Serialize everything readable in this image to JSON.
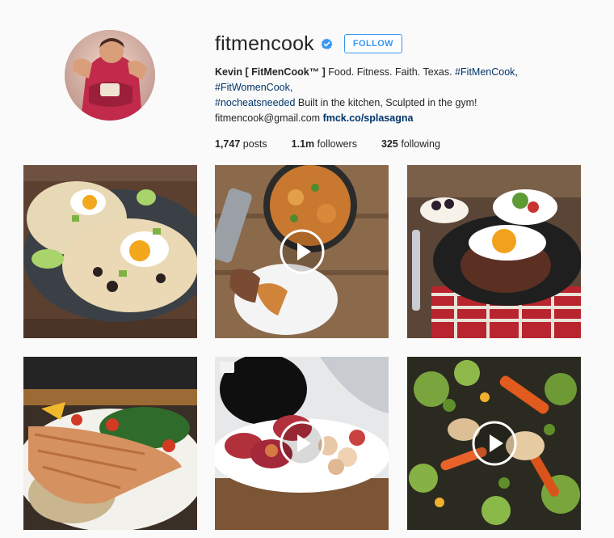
{
  "profile": {
    "username": "fitmencook",
    "follow_label": "FOLLOW",
    "bio": {
      "full_name": "Kevin [ FitMenCook™ ]",
      "text1": " Food. Fitness. Faith. Texas. ",
      "tag1": "#FitMenCook",
      "sep": ", ",
      "tag2": "#FitWomenCook",
      "sep2": ",",
      "tag3": "#nocheatsneeded",
      "text2": " Built in the kitchen, Sculpted in the gym!",
      "email": "fitmencook@gmail.com",
      "link": "fmck.co/splasagna"
    },
    "stats": {
      "posts_count": "1,747",
      "posts_label": "posts",
      "followers_count": "1.1m",
      "followers_label": "followers",
      "following_count": "325",
      "following_label": "following"
    }
  },
  "posts": [
    {
      "subject": "breakfast-tacos-egg-avocado",
      "video": false
    },
    {
      "subject": "lasagna-skillet",
      "video": true
    },
    {
      "subject": "burger-patty-egg-skillet",
      "video": false
    },
    {
      "subject": "salmon-brown-rice-kale",
      "video": false
    },
    {
      "subject": "stuffed-peppers-potatoes",
      "video": true
    },
    {
      "subject": "stir-fry-vegetables",
      "video": true
    }
  ],
  "colors": {
    "accent": "#3897f0",
    "link": "#003569",
    "background": "#fafafa"
  }
}
